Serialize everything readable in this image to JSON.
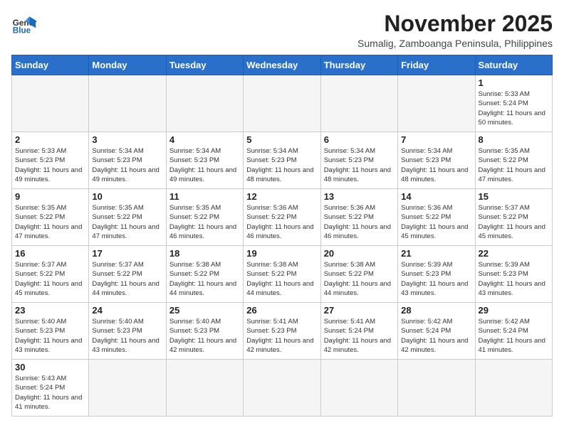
{
  "header": {
    "logo_general": "General",
    "logo_blue": "Blue",
    "month_title": "November 2025",
    "subtitle": "Sumalig, Zamboanga Peninsula, Philippines"
  },
  "days_of_week": [
    "Sunday",
    "Monday",
    "Tuesday",
    "Wednesday",
    "Thursday",
    "Friday",
    "Saturday"
  ],
  "weeks": [
    [
      {
        "day": "",
        "info": ""
      },
      {
        "day": "",
        "info": ""
      },
      {
        "day": "",
        "info": ""
      },
      {
        "day": "",
        "info": ""
      },
      {
        "day": "",
        "info": ""
      },
      {
        "day": "",
        "info": ""
      },
      {
        "day": "1",
        "info": "Sunrise: 5:33 AM\nSunset: 5:24 PM\nDaylight: 11 hours\nand 50 minutes."
      }
    ],
    [
      {
        "day": "2",
        "info": "Sunrise: 5:33 AM\nSunset: 5:23 PM\nDaylight: 11 hours\nand 49 minutes."
      },
      {
        "day": "3",
        "info": "Sunrise: 5:34 AM\nSunset: 5:23 PM\nDaylight: 11 hours\nand 49 minutes."
      },
      {
        "day": "4",
        "info": "Sunrise: 5:34 AM\nSunset: 5:23 PM\nDaylight: 11 hours\nand 49 minutes."
      },
      {
        "day": "5",
        "info": "Sunrise: 5:34 AM\nSunset: 5:23 PM\nDaylight: 11 hours\nand 48 minutes."
      },
      {
        "day": "6",
        "info": "Sunrise: 5:34 AM\nSunset: 5:23 PM\nDaylight: 11 hours\nand 48 minutes."
      },
      {
        "day": "7",
        "info": "Sunrise: 5:34 AM\nSunset: 5:23 PM\nDaylight: 11 hours\nand 48 minutes."
      },
      {
        "day": "8",
        "info": "Sunrise: 5:35 AM\nSunset: 5:22 PM\nDaylight: 11 hours\nand 47 minutes."
      }
    ],
    [
      {
        "day": "9",
        "info": "Sunrise: 5:35 AM\nSunset: 5:22 PM\nDaylight: 11 hours\nand 47 minutes."
      },
      {
        "day": "10",
        "info": "Sunrise: 5:35 AM\nSunset: 5:22 PM\nDaylight: 11 hours\nand 47 minutes."
      },
      {
        "day": "11",
        "info": "Sunrise: 5:35 AM\nSunset: 5:22 PM\nDaylight: 11 hours\nand 46 minutes."
      },
      {
        "day": "12",
        "info": "Sunrise: 5:36 AM\nSunset: 5:22 PM\nDaylight: 11 hours\nand 46 minutes."
      },
      {
        "day": "13",
        "info": "Sunrise: 5:36 AM\nSunset: 5:22 PM\nDaylight: 11 hours\nand 46 minutes."
      },
      {
        "day": "14",
        "info": "Sunrise: 5:36 AM\nSunset: 5:22 PM\nDaylight: 11 hours\nand 45 minutes."
      },
      {
        "day": "15",
        "info": "Sunrise: 5:37 AM\nSunset: 5:22 PM\nDaylight: 11 hours\nand 45 minutes."
      }
    ],
    [
      {
        "day": "16",
        "info": "Sunrise: 5:37 AM\nSunset: 5:22 PM\nDaylight: 11 hours\nand 45 minutes."
      },
      {
        "day": "17",
        "info": "Sunrise: 5:37 AM\nSunset: 5:22 PM\nDaylight: 11 hours\nand 44 minutes."
      },
      {
        "day": "18",
        "info": "Sunrise: 5:38 AM\nSunset: 5:22 PM\nDaylight: 11 hours\nand 44 minutes."
      },
      {
        "day": "19",
        "info": "Sunrise: 5:38 AM\nSunset: 5:22 PM\nDaylight: 11 hours\nand 44 minutes."
      },
      {
        "day": "20",
        "info": "Sunrise: 5:38 AM\nSunset: 5:22 PM\nDaylight: 11 hours\nand 44 minutes."
      },
      {
        "day": "21",
        "info": "Sunrise: 5:39 AM\nSunset: 5:23 PM\nDaylight: 11 hours\nand 43 minutes."
      },
      {
        "day": "22",
        "info": "Sunrise: 5:39 AM\nSunset: 5:23 PM\nDaylight: 11 hours\nand 43 minutes."
      }
    ],
    [
      {
        "day": "23",
        "info": "Sunrise: 5:40 AM\nSunset: 5:23 PM\nDaylight: 11 hours\nand 43 minutes."
      },
      {
        "day": "24",
        "info": "Sunrise: 5:40 AM\nSunset: 5:23 PM\nDaylight: 11 hours\nand 43 minutes."
      },
      {
        "day": "25",
        "info": "Sunrise: 5:40 AM\nSunset: 5:23 PM\nDaylight: 11 hours\nand 42 minutes."
      },
      {
        "day": "26",
        "info": "Sunrise: 5:41 AM\nSunset: 5:23 PM\nDaylight: 11 hours\nand 42 minutes."
      },
      {
        "day": "27",
        "info": "Sunrise: 5:41 AM\nSunset: 5:24 PM\nDaylight: 11 hours\nand 42 minutes."
      },
      {
        "day": "28",
        "info": "Sunrise: 5:42 AM\nSunset: 5:24 PM\nDaylight: 11 hours\nand 42 minutes."
      },
      {
        "day": "29",
        "info": "Sunrise: 5:42 AM\nSunset: 5:24 PM\nDaylight: 11 hours\nand 41 minutes."
      }
    ],
    [
      {
        "day": "30",
        "info": "Sunrise: 5:43 AM\nSunset: 5:24 PM\nDaylight: 11 hours\nand 41 minutes."
      },
      {
        "day": "",
        "info": ""
      },
      {
        "day": "",
        "info": ""
      },
      {
        "day": "",
        "info": ""
      },
      {
        "day": "",
        "info": ""
      },
      {
        "day": "",
        "info": ""
      },
      {
        "day": "",
        "info": ""
      }
    ]
  ]
}
